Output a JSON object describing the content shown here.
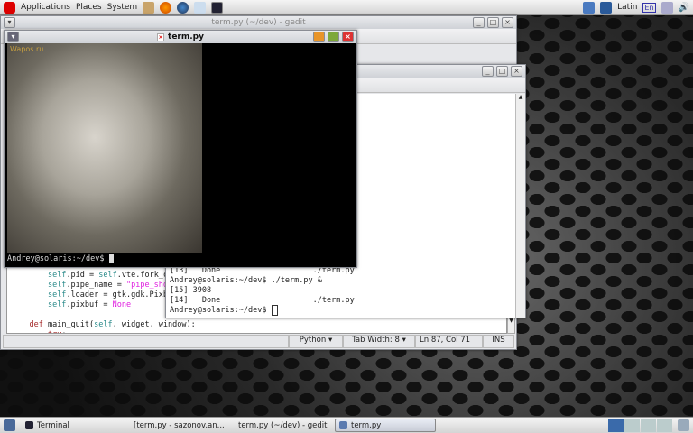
{
  "top_panel": {
    "menus": [
      "Applications",
      "Places",
      "System"
    ],
    "launchers": [
      "home-icon",
      "firefox-icon",
      "thunderbird-icon",
      "update-icon",
      "terminal-icon"
    ],
    "keyboard_layout": "Latin",
    "lang_indicator": "En"
  },
  "gedit": {
    "title": "term.py (~/dev) - gedit",
    "code": [
      {
        "indent": "        ",
        "parts": [
          [
            "sf",
            "self"
          ],
          [
            "",
            ".pid = "
          ],
          [
            "sf",
            "self"
          ],
          [
            "",
            ".vte.fork_comm"
          ]
        ]
      },
      {
        "indent": "        ",
        "parts": [
          [
            "sf",
            "self"
          ],
          [
            "",
            ".pipe_name = "
          ],
          [
            "st",
            "\"pipe_show_%"
          ]
        ]
      },
      {
        "indent": "        ",
        "parts": [
          [
            "sf",
            "self"
          ],
          [
            "",
            ".loader = gtk.gdk.PixbufL"
          ]
        ]
      },
      {
        "indent": "        ",
        "parts": [
          [
            "sf",
            "self"
          ],
          [
            "",
            ".pixbuf = "
          ],
          [
            "st",
            "None"
          ]
        ]
      },
      {
        "indent": "",
        "parts": []
      },
      {
        "indent": "    ",
        "parts": [
          [
            "kw",
            "def"
          ],
          [
            "",
            " main_quit("
          ],
          [
            "sf",
            "self"
          ],
          [
            "",
            ", widget, window):"
          ]
        ]
      },
      {
        "indent": "        ",
        "parts": [
          [
            "kw",
            "try"
          ],
          [
            "",
            ":"
          ]
        ]
      }
    ],
    "status": {
      "language": "Python",
      "tab_width": "Tab Width:  8",
      "position": "Ln 87, Col 71",
      "mode": "INS"
    }
  },
  "terminal_window": {
    "lines": [
      "[13]   Done                    ./term.py",
      "Andrey@solaris:~/dev$ ./term.py &",
      "[15] 3908",
      "[14]   Done                    ./term.py",
      "Andrey@solaris:~/dev$ "
    ]
  },
  "termpy": {
    "title": "term.py",
    "watermark": "Wapos.ru",
    "prompt": "Andrey@solaris:~/dev$ "
  },
  "taskbar": {
    "items": [
      {
        "label": "Terminal",
        "icon": "terminal-icon"
      },
      {
        "label": "[term.py - sazonov.an...",
        "icon": "firefox-icon"
      },
      {
        "label": "term.py (~/dev) - gedit",
        "icon": "gedit-icon"
      },
      {
        "label": "term.py",
        "icon": "window-icon",
        "active": true
      }
    ]
  }
}
